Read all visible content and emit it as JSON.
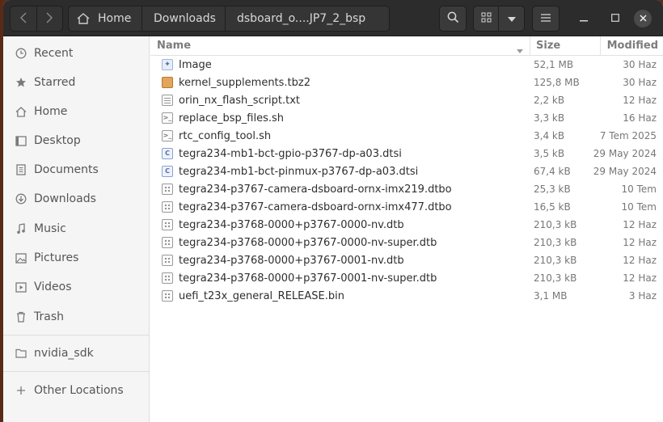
{
  "header": {
    "back_icon": "chevron-left-icon",
    "forward_icon": "chevron-right-icon",
    "breadcrumbs": [
      "Home",
      "Downloads",
      "dsboard_o....JP7_2_bsp"
    ],
    "search_icon": "search-icon",
    "view_icon": "grid-view-icon",
    "view_dropdown_icon": "chevron-down-icon",
    "menu_icon": "hamburger-menu-icon",
    "minimize_icon": "minimize-icon",
    "maximize_icon": "maximize-icon",
    "close_icon": "close-icon"
  },
  "sidebar": {
    "items": [
      {
        "label": "Recent",
        "icon": "clock-icon"
      },
      {
        "label": "Starred",
        "icon": "star-icon"
      },
      {
        "label": "Home",
        "icon": "home-icon"
      },
      {
        "label": "Desktop",
        "icon": "desktop-icon"
      },
      {
        "label": "Documents",
        "icon": "document-icon"
      },
      {
        "label": "Downloads",
        "icon": "download-icon"
      },
      {
        "label": "Music",
        "icon": "music-icon"
      },
      {
        "label": "Pictures",
        "icon": "picture-icon"
      },
      {
        "label": "Videos",
        "icon": "video-icon"
      },
      {
        "label": "Trash",
        "icon": "trash-icon"
      }
    ],
    "bookmarks": [
      {
        "label": "nvidia_sdk",
        "icon": "folder-icon"
      }
    ],
    "other_locations": {
      "label": "Other Locations",
      "icon": "plus-icon"
    }
  },
  "columns": {
    "name": "Name",
    "size": "Size",
    "modified": "Modified"
  },
  "files": [
    {
      "name": "Image",
      "size": "52,1 MB",
      "modified": "30 Haz",
      "type": "image"
    },
    {
      "name": "kernel_supplements.tbz2",
      "size": "125,8 MB",
      "modified": "30 Haz",
      "type": "archive"
    },
    {
      "name": "orin_nx_flash_script.txt",
      "size": "2,2 kB",
      "modified": "12 Haz",
      "type": "text"
    },
    {
      "name": "replace_bsp_files.sh",
      "size": "3,3 kB",
      "modified": "16 Haz",
      "type": "script"
    },
    {
      "name": "rtc_config_tool.sh",
      "size": "3,4 kB",
      "modified": "7 Tem 2025",
      "type": "script"
    },
    {
      "name": "tegra234-mb1-bct-gpio-p3767-dp-a03.dtsi",
      "size": "3,5 kB",
      "modified": "29 May 2024",
      "type": "csrc"
    },
    {
      "name": "tegra234-mb1-bct-pinmux-p3767-dp-a03.dtsi",
      "size": "67,4 kB",
      "modified": "29 May 2024",
      "type": "csrc"
    },
    {
      "name": "tegra234-p3767-camera-dsboard-ornx-imx219.dtbo",
      "size": "25,3 kB",
      "modified": "10 Tem",
      "type": "binary"
    },
    {
      "name": "tegra234-p3767-camera-dsboard-ornx-imx477.dtbo",
      "size": "16,5 kB",
      "modified": "10 Tem",
      "type": "binary"
    },
    {
      "name": "tegra234-p3768-0000+p3767-0000-nv.dtb",
      "size": "210,3 kB",
      "modified": "12 Haz",
      "type": "binary"
    },
    {
      "name": "tegra234-p3768-0000+p3767-0000-nv-super.dtb",
      "size": "210,3 kB",
      "modified": "12 Haz",
      "type": "binary"
    },
    {
      "name": "tegra234-p3768-0000+p3767-0001-nv.dtb",
      "size": "210,3 kB",
      "modified": "12 Haz",
      "type": "binary"
    },
    {
      "name": "tegra234-p3768-0000+p3767-0001-nv-super.dtb",
      "size": "210,3 kB",
      "modified": "12 Haz",
      "type": "binary"
    },
    {
      "name": "uefi_t23x_general_RELEASE.bin",
      "size": "3,1 MB",
      "modified": "3 Haz",
      "type": "binary"
    }
  ]
}
